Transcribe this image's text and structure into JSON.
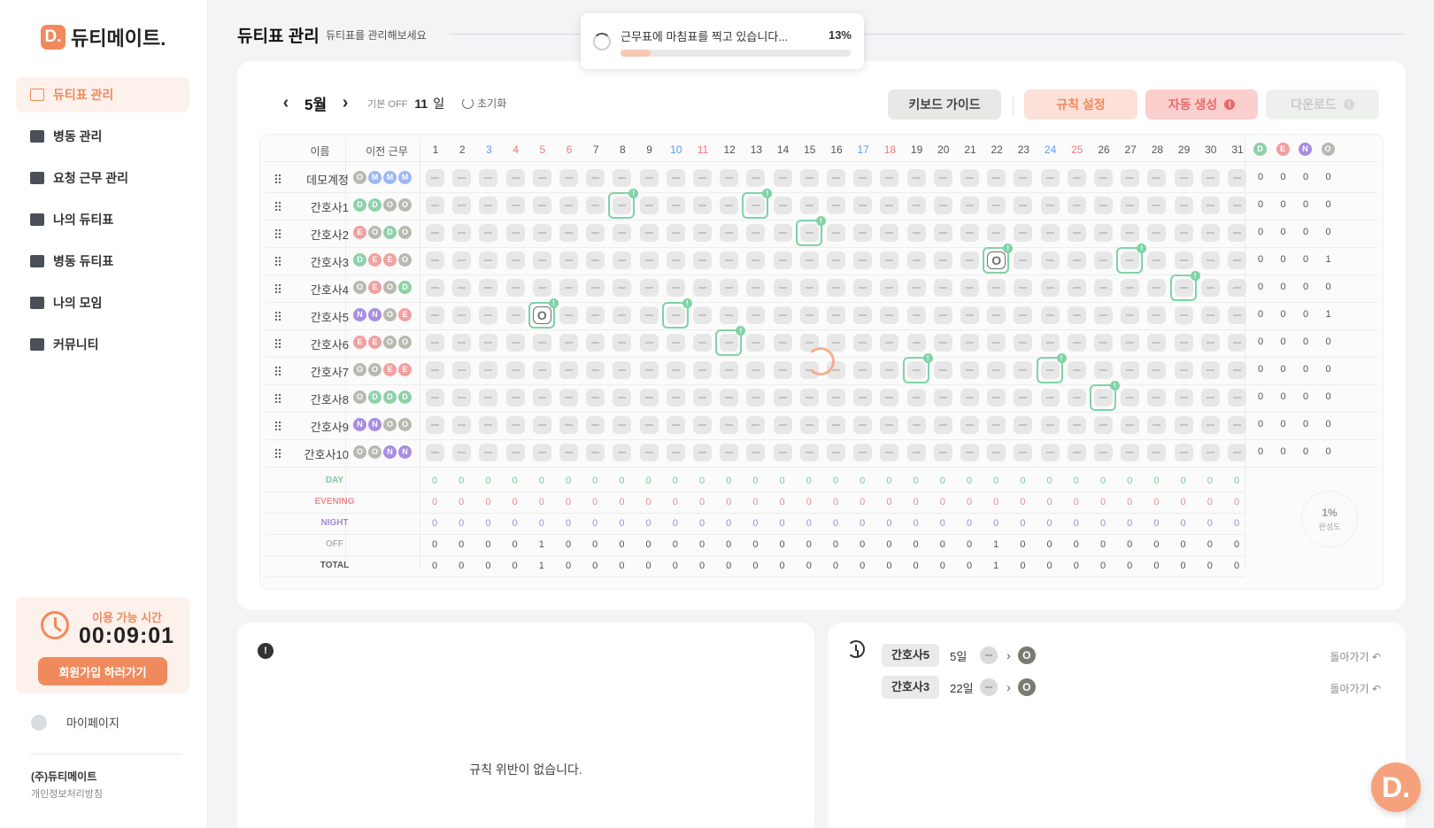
{
  "brand": {
    "badge": "D.",
    "name": "듀티메이트."
  },
  "sidebar": {
    "items": [
      {
        "label": "듀티표 관리",
        "icon": "calendar-icon",
        "active": true
      },
      {
        "label": "병동 관리",
        "icon": "hospital-icon"
      },
      {
        "label": "요청 근무 관리",
        "icon": "request-calendar-icon"
      },
      {
        "label": "나의 듀티표",
        "icon": "person-card-icon"
      },
      {
        "label": "병동 듀티표",
        "icon": "people-icon"
      },
      {
        "label": "나의 모임",
        "icon": "cup-icon"
      },
      {
        "label": "커뮤니티",
        "icon": "chat-icon"
      }
    ],
    "timer_label": "이용 가능 시간",
    "timer_value": "00:09:01",
    "signup_label": "회원가입 하러가기",
    "mypage_label": "마이페이지",
    "company": "(주)듀티메이트",
    "privacy": "개인정보처리방침"
  },
  "header": {
    "title": "듀티표 관리",
    "subtitle": "듀티표를 관리해보세요"
  },
  "toast": {
    "message": "근무표에 마침표를 찍고 있습니다...",
    "percent_label": "13%",
    "progress": 0.13
  },
  "toolbar": {
    "month": "5월",
    "off_label": "기본 OFF",
    "off_value": "11",
    "off_unit": "일",
    "reset_label": "초기화",
    "keyboard_guide": "키보드 가이드",
    "rule_setting": "규칙 설정",
    "auto_generate": "자동 생성",
    "download": "다운로드"
  },
  "grid": {
    "name_header": "이름",
    "prev_header": "이전 근무",
    "days": [
      "1",
      "2",
      "3",
      "4",
      "5",
      "6",
      "7",
      "8",
      "9",
      "10",
      "11",
      "12",
      "13",
      "14",
      "15",
      "16",
      "17",
      "18",
      "19",
      "20",
      "21",
      "22",
      "23",
      "24",
      "25",
      "26",
      "27",
      "28",
      "29",
      "30",
      "31"
    ],
    "day_colors": [
      "",
      "",
      "sat",
      "sun",
      "hol",
      "hol",
      "",
      "",
      "",
      "sat",
      "sun",
      "",
      "",
      "",
      "",
      "",
      "sat",
      "sun",
      "",
      "",
      "",
      "",
      "",
      "sat",
      "sun",
      "",
      "",
      "",
      "",
      "",
      ""
    ],
    "stat_headers": [
      "D",
      "E",
      "N",
      "O"
    ],
    "rows": [
      {
        "name": "데모계정",
        "prev": [
          "O",
          "M",
          "M",
          "M"
        ],
        "stats": [
          "0",
          "0",
          "0",
          "0"
        ],
        "assigned": {},
        "highlight": []
      },
      {
        "name": "간호사1",
        "prev": [
          "D",
          "D",
          "O",
          "O"
        ],
        "stats": [
          "0",
          "0",
          "0",
          "0"
        ],
        "assigned": {},
        "highlight": [
          8,
          13
        ]
      },
      {
        "name": "간호사2",
        "prev": [
          "E",
          "O",
          "D",
          "O"
        ],
        "stats": [
          "0",
          "0",
          "0",
          "0"
        ],
        "assigned": {},
        "highlight": [
          15
        ]
      },
      {
        "name": "간호사3",
        "prev": [
          "D",
          "E",
          "E",
          "O"
        ],
        "stats": [
          "0",
          "0",
          "0",
          "1"
        ],
        "assigned": {
          "22": "O"
        },
        "highlight": [
          22,
          27
        ]
      },
      {
        "name": "간호사4",
        "prev": [
          "O",
          "E",
          "O",
          "D"
        ],
        "stats": [
          "0",
          "0",
          "0",
          "0"
        ],
        "assigned": {},
        "highlight": [
          29
        ]
      },
      {
        "name": "간호사5",
        "prev": [
          "N",
          "N",
          "O",
          "E"
        ],
        "stats": [
          "0",
          "0",
          "0",
          "1"
        ],
        "assigned": {
          "5": "O"
        },
        "highlight": [
          5,
          10
        ]
      },
      {
        "name": "간호사6",
        "prev": [
          "E",
          "E",
          "O",
          "O"
        ],
        "stats": [
          "0",
          "0",
          "0",
          "0"
        ],
        "assigned": {},
        "highlight": [
          12
        ]
      },
      {
        "name": "간호사7",
        "prev": [
          "O",
          "O",
          "E",
          "E"
        ],
        "stats": [
          "0",
          "0",
          "0",
          "0"
        ],
        "assigned": {},
        "highlight": [
          19,
          24
        ]
      },
      {
        "name": "간호사8",
        "prev": [
          "O",
          "D",
          "D",
          "D"
        ],
        "stats": [
          "0",
          "0",
          "0",
          "0"
        ],
        "assigned": {},
        "highlight": [
          26
        ]
      },
      {
        "name": "간호사9",
        "prev": [
          "N",
          "N",
          "O",
          "O"
        ],
        "stats": [
          "0",
          "0",
          "0",
          "0"
        ],
        "assigned": {},
        "highlight": []
      },
      {
        "name": "간호사10",
        "prev": [
          "O",
          "O",
          "N",
          "N"
        ],
        "stats": [
          "0",
          "0",
          "0",
          "0"
        ],
        "assigned": {},
        "highlight": []
      }
    ],
    "summary": [
      {
        "label": "DAY",
        "color": "#7fc79a",
        "values": [
          "0",
          "0",
          "0",
          "0",
          "0",
          "0",
          "0",
          "0",
          "0",
          "0",
          "0",
          "0",
          "0",
          "0",
          "0",
          "0",
          "0",
          "0",
          "0",
          "0",
          "0",
          "0",
          "0",
          "0",
          "0",
          "0",
          "0",
          "0",
          "0",
          "0",
          "0"
        ]
      },
      {
        "label": "EVENING",
        "color": "#ee8d8d",
        "values": [
          "0",
          "0",
          "0",
          "0",
          "0",
          "0",
          "0",
          "0",
          "0",
          "0",
          "0",
          "0",
          "0",
          "0",
          "0",
          "0",
          "0",
          "0",
          "0",
          "0",
          "0",
          "0",
          "0",
          "0",
          "0",
          "0",
          "0",
          "0",
          "0",
          "0",
          "0"
        ]
      },
      {
        "label": "NIGHT",
        "color": "#a58bd8",
        "values": [
          "0",
          "0",
          "0",
          "0",
          "0",
          "0",
          "0",
          "0",
          "0",
          "0",
          "0",
          "0",
          "0",
          "0",
          "0",
          "0",
          "0",
          "0",
          "0",
          "0",
          "0",
          "0",
          "0",
          "0",
          "0",
          "0",
          "0",
          "0",
          "0",
          "0",
          "0"
        ]
      },
      {
        "label": "OFF",
        "color": "#b4b4ac",
        "values": [
          "0",
          "0",
          "0",
          "0",
          "1",
          "0",
          "0",
          "0",
          "0",
          "0",
          "0",
          "0",
          "0",
          "0",
          "0",
          "0",
          "0",
          "0",
          "0",
          "0",
          "0",
          "1",
          "0",
          "0",
          "0",
          "0",
          "0",
          "0",
          "0",
          "0",
          "0"
        ]
      },
      {
        "label": "TOTAL",
        "color": "#555555",
        "values": [
          "0",
          "0",
          "0",
          "0",
          "1",
          "0",
          "0",
          "0",
          "0",
          "0",
          "0",
          "0",
          "0",
          "0",
          "0",
          "0",
          "0",
          "0",
          "0",
          "0",
          "0",
          "1",
          "0",
          "0",
          "0",
          "0",
          "0",
          "0",
          "0",
          "0",
          "0"
        ]
      }
    ],
    "completion_pct": "1%",
    "completion_label": "완성도"
  },
  "shift_colors": {
    "D": "#8fd1a8",
    "E": "#f1a0a0",
    "N": "#a78ee0",
    "O": "#b9b9b1",
    "M": "#9cb8f2"
  },
  "rule_panel": {
    "empty_message": "규칙 위반이 없습니다."
  },
  "history": {
    "items": [
      {
        "name": "간호사5",
        "day": "5일",
        "to": "O",
        "revert": "돌아가기"
      },
      {
        "name": "간호사3",
        "day": "22일",
        "to": "O",
        "revert": "돌아가기"
      }
    ]
  },
  "fab": {
    "label": "D."
  }
}
